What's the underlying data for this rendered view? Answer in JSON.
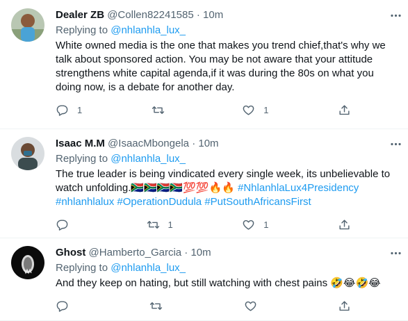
{
  "tweets": [
    {
      "name": "Dealer ZB",
      "handle": "@Collen82241585",
      "sep": "·",
      "time": "10m",
      "replying_label": "Replying to",
      "replying_to": "@nhlanhla_lux_",
      "text": "White owned media is the one that makes you trend chief,that's why we talk about sponsored action. You may be not aware that your attitude strengthens white capital agenda,if it was  during the 80s on what you doing now, is a debate for another day.",
      "reply_count": "1",
      "retweet_count": "",
      "like_count": "1",
      "icons": [
        "more-icon",
        "reply-icon",
        "retweet-icon",
        "like-icon",
        "share-icon"
      ]
    },
    {
      "name": "Isaac M.M",
      "handle": "@IsaacMbongela",
      "sep": "·",
      "time": "10m",
      "replying_label": "Replying to",
      "replying_to": "@nhlanhla_lux_",
      "text_plain": "The true leader is being vindicated every single week, its unbelievable to watch unfolding.🇿🇦🇿🇦🇿🇦🇿🇦💯💯🔥🔥 ",
      "hashtags_line1": "#NhlanhlaLux4Presidency",
      "hashtags_line2": "#nhlanhlalux #OperationDudula #PutSouthAfricansFirst",
      "reply_count": "",
      "retweet_count": "1",
      "like_count": "1"
    },
    {
      "name": "Ghost",
      "handle": "@Hamberto_Garcia",
      "sep": "·",
      "time": "10m",
      "replying_label": "Replying to",
      "replying_to": "@nhlanhla_lux_",
      "text": "And they keep on hating, but still watching with chest pains 🤣😂🤣😂",
      "reply_count": "",
      "retweet_count": "",
      "like_count": ""
    }
  ],
  "colors": {
    "accent": "#1d9bf0",
    "muted": "#536471",
    "text": "#0f1419",
    "divider": "#eff3f4"
  }
}
